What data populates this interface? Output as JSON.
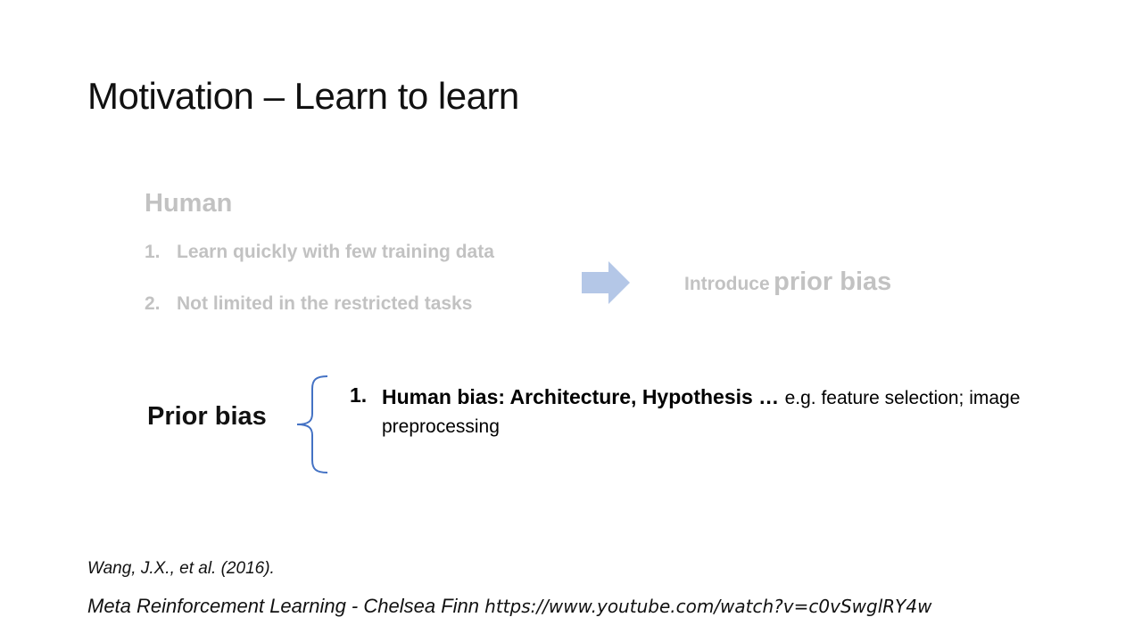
{
  "slide": {
    "title": "Motivation – Learn to learn",
    "human": {
      "heading": "Human",
      "items": [
        {
          "num": "1.",
          "text": "Learn quickly with few training data"
        },
        {
          "num": "2.",
          "text": "Not limited in the restricted tasks"
        }
      ]
    },
    "arrow_icon": "right-arrow-icon",
    "introduce": {
      "small": "Introduce",
      "big": "prior bias"
    },
    "prior": {
      "label": "Prior bias",
      "brace_icon": "curly-brace-icon",
      "items": [
        {
          "num": "1.",
          "head": "Human bias: Architecture, Hypothesis …",
          "rest": "e.g. feature selection; image preprocessing"
        }
      ]
    },
    "citation": "Wang, J.X., et al. (2016).",
    "reference": {
      "text": "Meta Reinforcement Learning - Chelsea Finn",
      "url": "https://www.youtube.com/watch?v=c0vSwglRY4w"
    },
    "colors": {
      "faded_text": "#c2c2c2",
      "arrow": "#b4c7e7",
      "brace": "#4472c4"
    }
  }
}
